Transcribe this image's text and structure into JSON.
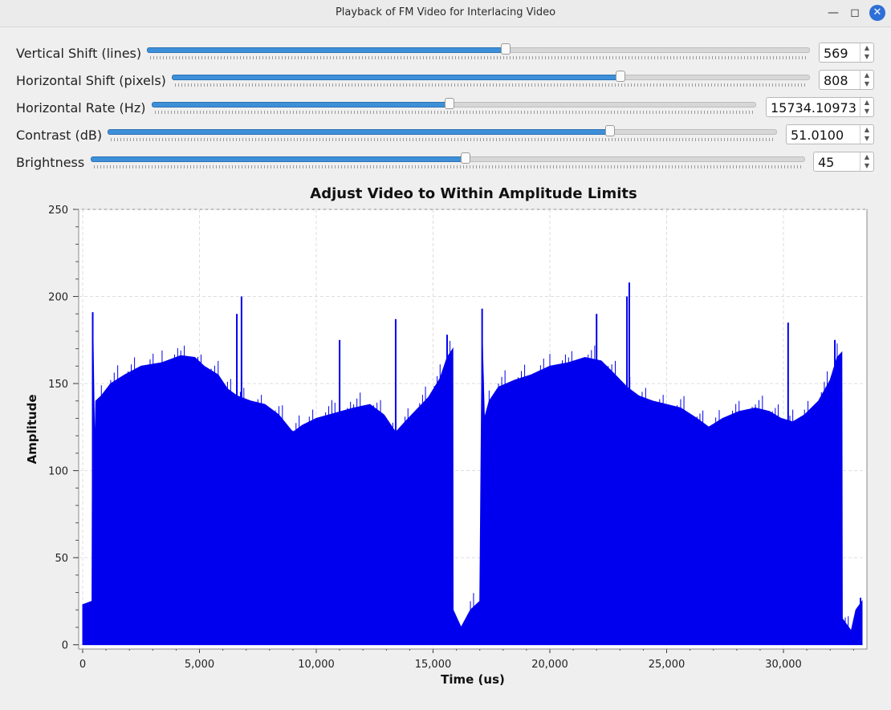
{
  "window": {
    "title": "Playback of FM Video for Interlacing Video",
    "minimize_icon": "minimize-icon",
    "maximize_icon": "maximize-icon",
    "close_icon": "close-icon"
  },
  "controls": [
    {
      "id": "vertical-shift",
      "label": "Vertical Shift (lines)",
      "value": "569",
      "fraction": 0.541
    },
    {
      "id": "horizontal-shift",
      "label": "Horizontal Shift (pixels)",
      "value": "808",
      "fraction": 0.703
    },
    {
      "id": "horizontal-rate",
      "label": "Horizontal Rate (Hz)",
      "value": "15734.10973",
      "fraction": 0.493
    },
    {
      "id": "contrast",
      "label": "Contrast (dB)",
      "value": "51.0100",
      "fraction": 0.75
    },
    {
      "id": "brightness",
      "label": "Brightness",
      "value": "45",
      "fraction": 0.525
    }
  ],
  "chart_data": {
    "type": "line",
    "title": "Adjust Video to Within Amplitude Limits",
    "xlabel": "Time (us)",
    "ylabel": "Amplitude",
    "xlim": [
      0,
      33367
    ],
    "ylim": [
      -2,
      250
    ],
    "xticks": [
      0,
      5000,
      10000,
      15000,
      20000,
      25000,
      30000
    ],
    "xtick_labels": [
      "0",
      "5,000",
      "10,000",
      "15,000",
      "20,000",
      "25,000",
      "30,000"
    ],
    "yticks": [
      0,
      50,
      100,
      150,
      200,
      250
    ],
    "ytick_labels": [
      "0",
      "50",
      "100",
      "150",
      "200",
      "250"
    ],
    "grid": true,
    "series": [
      {
        "color": "#0000ee",
        "envelope": [
          [
            0,
            23
          ],
          [
            400,
            25
          ],
          [
            430,
            190
          ],
          [
            520,
            110
          ],
          [
            560,
            140
          ],
          [
            800,
            143
          ],
          [
            1200,
            150
          ],
          [
            1800,
            155
          ],
          [
            2500,
            160
          ],
          [
            3400,
            162
          ],
          [
            4200,
            166
          ],
          [
            4800,
            165
          ],
          [
            5200,
            160
          ],
          [
            5800,
            155
          ],
          [
            6200,
            147
          ],
          [
            6600,
            143
          ],
          [
            7200,
            140
          ],
          [
            7800,
            138
          ],
          [
            8400,
            132
          ],
          [
            9000,
            122
          ],
          [
            9400,
            126
          ],
          [
            10000,
            130
          ],
          [
            10800,
            133
          ],
          [
            11600,
            136
          ],
          [
            12300,
            138
          ],
          [
            12900,
            132
          ],
          [
            13400,
            122
          ],
          [
            13800,
            128
          ],
          [
            14300,
            135
          ],
          [
            14800,
            142
          ],
          [
            15300,
            153
          ],
          [
            15600,
            165
          ],
          [
            15850,
            170
          ],
          [
            15860,
            20
          ],
          [
            16200,
            10
          ],
          [
            16600,
            20
          ],
          [
            17000,
            25
          ],
          [
            17100,
            180
          ],
          [
            17200,
            130
          ],
          [
            17400,
            140
          ],
          [
            17800,
            148
          ],
          [
            18500,
            152
          ],
          [
            19200,
            155
          ],
          [
            20000,
            160
          ],
          [
            20800,
            162
          ],
          [
            21500,
            165
          ],
          [
            22200,
            163
          ],
          [
            22800,
            155
          ],
          [
            23300,
            148
          ],
          [
            23800,
            143
          ],
          [
            24400,
            140
          ],
          [
            25000,
            138
          ],
          [
            25600,
            136
          ],
          [
            26300,
            130
          ],
          [
            26800,
            125
          ],
          [
            27400,
            130
          ],
          [
            28100,
            134
          ],
          [
            28800,
            136
          ],
          [
            29400,
            134
          ],
          [
            29900,
            130
          ],
          [
            30400,
            128
          ],
          [
            30900,
            132
          ],
          [
            31500,
            140
          ],
          [
            32000,
            152
          ],
          [
            32300,
            165
          ],
          [
            32500,
            168
          ],
          [
            32520,
            15
          ],
          [
            32900,
            8
          ],
          [
            33100,
            20
          ],
          [
            33367,
            25
          ]
        ],
        "spikes": [
          [
            430,
            191
          ],
          [
            6800,
            200
          ],
          [
            6600,
            190
          ],
          [
            13400,
            187
          ],
          [
            11000,
            175
          ],
          [
            15600,
            178
          ],
          [
            17100,
            193
          ],
          [
            23400,
            208
          ],
          [
            23300,
            200
          ],
          [
            22000,
            190
          ],
          [
            30200,
            185
          ],
          [
            32200,
            175
          ],
          [
            33300,
            27
          ]
        ]
      }
    ]
  }
}
